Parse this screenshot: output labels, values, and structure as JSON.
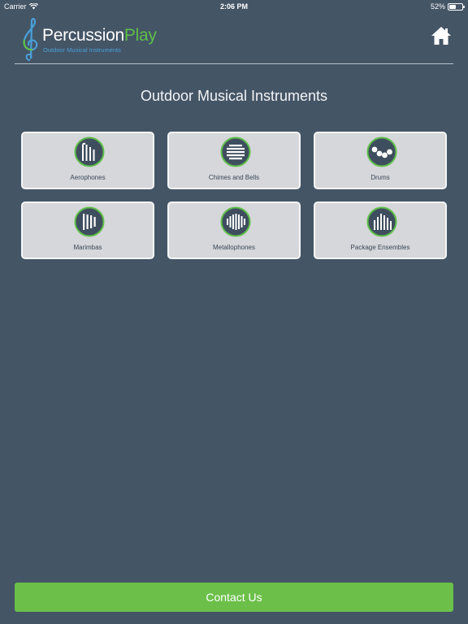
{
  "status_bar": {
    "carrier": "Carrier",
    "time": "2:06 PM",
    "battery": "52%",
    "battery_level": 0.52
  },
  "header": {
    "logo_word1": "Percussion",
    "logo_word2": "Play",
    "logo_subtitle": "Outdoor Musical Instruments",
    "home_icon": "home-icon"
  },
  "main": {
    "title": "Outdoor Musical Instruments",
    "categories": [
      {
        "label": "Aerophones",
        "icon": "aerophones-icon"
      },
      {
        "label": "Chimes and Bells",
        "icon": "chimes-icon"
      },
      {
        "label": "Drums",
        "icon": "drums-icon"
      },
      {
        "label": "Marimbas",
        "icon": "marimbas-icon"
      },
      {
        "label": "Metallophones",
        "icon": "metallophones-icon"
      },
      {
        "label": "Package Ensembles",
        "icon": "ensembles-icon"
      }
    ]
  },
  "footer": {
    "contact_label": "Contact Us"
  },
  "colors": {
    "background": "#445566",
    "accent_green": "#6cc04a",
    "tile_background": "#d5d7da",
    "icon_circle": "#3f4e5e",
    "logo_blue": "#4aa0d8"
  }
}
